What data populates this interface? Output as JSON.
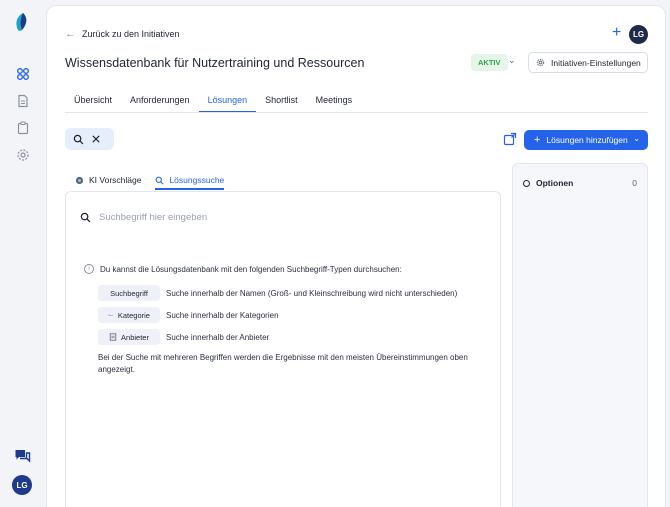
{
  "user": {
    "initials": "LG"
  },
  "header": {
    "back_label": "Zurück zu den Initiativen",
    "title": "Wissensdatenbank für Nutzertraining und Ressourcen",
    "status": "AKTIV",
    "settings_label": "Initiativen-Einstellungen"
  },
  "tabs": [
    {
      "label": "Übersicht"
    },
    {
      "label": "Anforderungen"
    },
    {
      "label": "Lösungen",
      "active": true
    },
    {
      "label": "Shortlist"
    },
    {
      "label": "Meetings"
    }
  ],
  "toolbar": {
    "add_label": "Lösungen hinzufügen"
  },
  "subtabs": [
    {
      "label": "KI Vorschläge"
    },
    {
      "label": "Lösungssuche",
      "active": true
    }
  ],
  "search": {
    "placeholder": "Suchbegriff hier eingeben",
    "value": ""
  },
  "info": {
    "intro": "Du kannst die Lösungsdatenbank mit den folgenden Suchbegriff-Typen durchsuchen:",
    "types": [
      {
        "chip": "Suchbegriff",
        "icon": "none",
        "desc": "Suche innerhalb der Namen (Groß- und Kleinschreibung wird nicht unterschieden)"
      },
      {
        "chip": "Kategorie",
        "icon": "tree-icon",
        "desc": "Suche innerhalb der Kategorien"
      },
      {
        "chip": "Anbieter",
        "icon": "document-icon",
        "desc": "Suche innerhalb der Anbieter"
      }
    ],
    "footnote": "Bei der Suche mit mehreren Begriffen werden die Ergebnisse mit den meisten Übereinstimmungen oben angezeigt."
  },
  "options": {
    "label": "Optionen",
    "count": "0"
  },
  "colors": {
    "accent": "#2563eb",
    "status_bg": "#e5f6e9",
    "status_fg": "#2f9e4f",
    "avatar": "#1e2a4a"
  }
}
